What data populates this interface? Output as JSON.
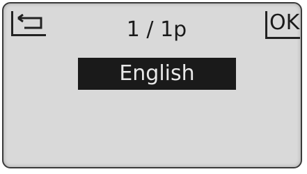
{
  "header": {
    "back_icon": "return-arrow-icon",
    "page_indicator": "1 / 1p",
    "ok_label": "OK"
  },
  "menu": {
    "items": [
      {
        "label": "English",
        "selected": true
      }
    ]
  },
  "colors": {
    "screen_background": "#d9d9d9",
    "highlight_background": "#1a1a1a",
    "highlight_text": "#e8e8e8",
    "text": "#1a1a1a"
  }
}
